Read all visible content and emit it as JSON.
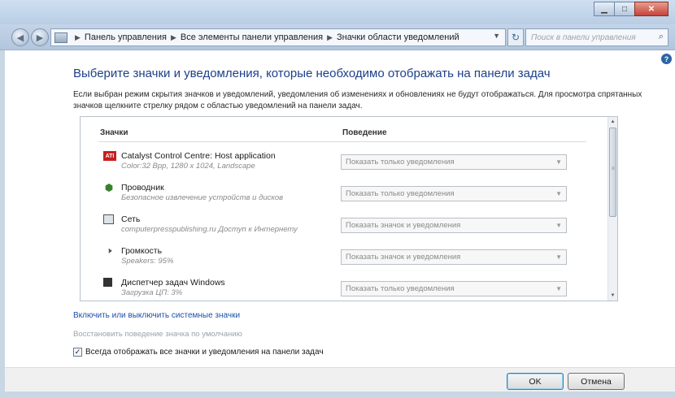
{
  "address": {
    "crumbs": [
      "Панель управления",
      "Все элементы панели управления",
      "Значки области уведомлений"
    ],
    "search_placeholder": "Поиск в панели управления"
  },
  "page": {
    "title": "Выберите значки и уведомления, которые необходимо отображать на панели задач",
    "description": "Если выбран режим скрытия значков и уведомлений, уведомления об изменениях и обновлениях не будут отображаться. Для просмотра спрятанных значков щелкните стрелку рядом с областью уведомлений на панели задач."
  },
  "list": {
    "col_icons": "Значки",
    "col_behavior": "Поведение",
    "rows": [
      {
        "icon": "ati-icon",
        "name": "Catalyst Control Centre: Host application",
        "sub": "Color:32 Bpp, 1280 x 1024, Landscape",
        "behavior": "Показать только уведомления"
      },
      {
        "icon": "explorer-icon",
        "name": "Проводник",
        "sub": "Безопасное извлечение устройств и дисков",
        "behavior": "Показать только уведомления"
      },
      {
        "icon": "network-icon",
        "name": "Сеть",
        "sub": "computerpresspublishing.ru Доступ к Интернету",
        "behavior": "Показать значок и уведомления"
      },
      {
        "icon": "volume-icon",
        "name": "Громкость",
        "sub": "Speakers: 95%",
        "behavior": "Показать значок и уведомления"
      },
      {
        "icon": "task-manager-icon",
        "name": "Диспетчер задач Windows",
        "sub": "Загрузка ЦП: 3%",
        "behavior": "Показать только уведомления"
      }
    ]
  },
  "links": {
    "system_icons": "Включить или выключить системные значки",
    "restore_default": "Восстановить поведение значка по умолчанию"
  },
  "always_show": {
    "label": "Всегда отображать все значки и уведомления на панели задач",
    "checked": true
  },
  "buttons": {
    "ok": "OK",
    "cancel": "Отмена"
  }
}
